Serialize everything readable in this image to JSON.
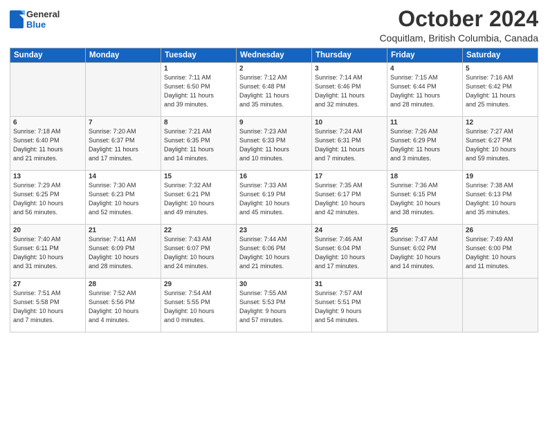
{
  "header": {
    "logo_general": "General",
    "logo_blue": "Blue",
    "title": "October 2024",
    "location": "Coquitlam, British Columbia, Canada"
  },
  "days_of_week": [
    "Sunday",
    "Monday",
    "Tuesday",
    "Wednesday",
    "Thursday",
    "Friday",
    "Saturday"
  ],
  "weeks": [
    [
      {
        "day": "",
        "info": "",
        "empty": true
      },
      {
        "day": "",
        "info": "",
        "empty": true
      },
      {
        "day": "1",
        "info": "Sunrise: 7:11 AM\nSunset: 6:50 PM\nDaylight: 11 hours\nand 39 minutes."
      },
      {
        "day": "2",
        "info": "Sunrise: 7:12 AM\nSunset: 6:48 PM\nDaylight: 11 hours\nand 35 minutes."
      },
      {
        "day": "3",
        "info": "Sunrise: 7:14 AM\nSunset: 6:46 PM\nDaylight: 11 hours\nand 32 minutes."
      },
      {
        "day": "4",
        "info": "Sunrise: 7:15 AM\nSunset: 6:44 PM\nDaylight: 11 hours\nand 28 minutes."
      },
      {
        "day": "5",
        "info": "Sunrise: 7:16 AM\nSunset: 6:42 PM\nDaylight: 11 hours\nand 25 minutes."
      }
    ],
    [
      {
        "day": "6",
        "info": "Sunrise: 7:18 AM\nSunset: 6:40 PM\nDaylight: 11 hours\nand 21 minutes."
      },
      {
        "day": "7",
        "info": "Sunrise: 7:20 AM\nSunset: 6:37 PM\nDaylight: 11 hours\nand 17 minutes."
      },
      {
        "day": "8",
        "info": "Sunrise: 7:21 AM\nSunset: 6:35 PM\nDaylight: 11 hours\nand 14 minutes."
      },
      {
        "day": "9",
        "info": "Sunrise: 7:23 AM\nSunset: 6:33 PM\nDaylight: 11 hours\nand 10 minutes."
      },
      {
        "day": "10",
        "info": "Sunrise: 7:24 AM\nSunset: 6:31 PM\nDaylight: 11 hours\nand 7 minutes."
      },
      {
        "day": "11",
        "info": "Sunrise: 7:26 AM\nSunset: 6:29 PM\nDaylight: 11 hours\nand 3 minutes."
      },
      {
        "day": "12",
        "info": "Sunrise: 7:27 AM\nSunset: 6:27 PM\nDaylight: 10 hours\nand 59 minutes."
      }
    ],
    [
      {
        "day": "13",
        "info": "Sunrise: 7:29 AM\nSunset: 6:25 PM\nDaylight: 10 hours\nand 56 minutes."
      },
      {
        "day": "14",
        "info": "Sunrise: 7:30 AM\nSunset: 6:23 PM\nDaylight: 10 hours\nand 52 minutes."
      },
      {
        "day": "15",
        "info": "Sunrise: 7:32 AM\nSunset: 6:21 PM\nDaylight: 10 hours\nand 49 minutes."
      },
      {
        "day": "16",
        "info": "Sunrise: 7:33 AM\nSunset: 6:19 PM\nDaylight: 10 hours\nand 45 minutes."
      },
      {
        "day": "17",
        "info": "Sunrise: 7:35 AM\nSunset: 6:17 PM\nDaylight: 10 hours\nand 42 minutes."
      },
      {
        "day": "18",
        "info": "Sunrise: 7:36 AM\nSunset: 6:15 PM\nDaylight: 10 hours\nand 38 minutes."
      },
      {
        "day": "19",
        "info": "Sunrise: 7:38 AM\nSunset: 6:13 PM\nDaylight: 10 hours\nand 35 minutes."
      }
    ],
    [
      {
        "day": "20",
        "info": "Sunrise: 7:40 AM\nSunset: 6:11 PM\nDaylight: 10 hours\nand 31 minutes."
      },
      {
        "day": "21",
        "info": "Sunrise: 7:41 AM\nSunset: 6:09 PM\nDaylight: 10 hours\nand 28 minutes."
      },
      {
        "day": "22",
        "info": "Sunrise: 7:43 AM\nSunset: 6:07 PM\nDaylight: 10 hours\nand 24 minutes."
      },
      {
        "day": "23",
        "info": "Sunrise: 7:44 AM\nSunset: 6:06 PM\nDaylight: 10 hours\nand 21 minutes."
      },
      {
        "day": "24",
        "info": "Sunrise: 7:46 AM\nSunset: 6:04 PM\nDaylight: 10 hours\nand 17 minutes."
      },
      {
        "day": "25",
        "info": "Sunrise: 7:47 AM\nSunset: 6:02 PM\nDaylight: 10 hours\nand 14 minutes."
      },
      {
        "day": "26",
        "info": "Sunrise: 7:49 AM\nSunset: 6:00 PM\nDaylight: 10 hours\nand 11 minutes."
      }
    ],
    [
      {
        "day": "27",
        "info": "Sunrise: 7:51 AM\nSunset: 5:58 PM\nDaylight: 10 hours\nand 7 minutes."
      },
      {
        "day": "28",
        "info": "Sunrise: 7:52 AM\nSunset: 5:56 PM\nDaylight: 10 hours\nand 4 minutes."
      },
      {
        "day": "29",
        "info": "Sunrise: 7:54 AM\nSunset: 5:55 PM\nDaylight: 10 hours\nand 0 minutes."
      },
      {
        "day": "30",
        "info": "Sunrise: 7:55 AM\nSunset: 5:53 PM\nDaylight: 9 hours\nand 57 minutes."
      },
      {
        "day": "31",
        "info": "Sunrise: 7:57 AM\nSunset: 5:51 PM\nDaylight: 9 hours\nand 54 minutes."
      },
      {
        "day": "",
        "info": "",
        "empty": true
      },
      {
        "day": "",
        "info": "",
        "empty": true
      }
    ]
  ]
}
